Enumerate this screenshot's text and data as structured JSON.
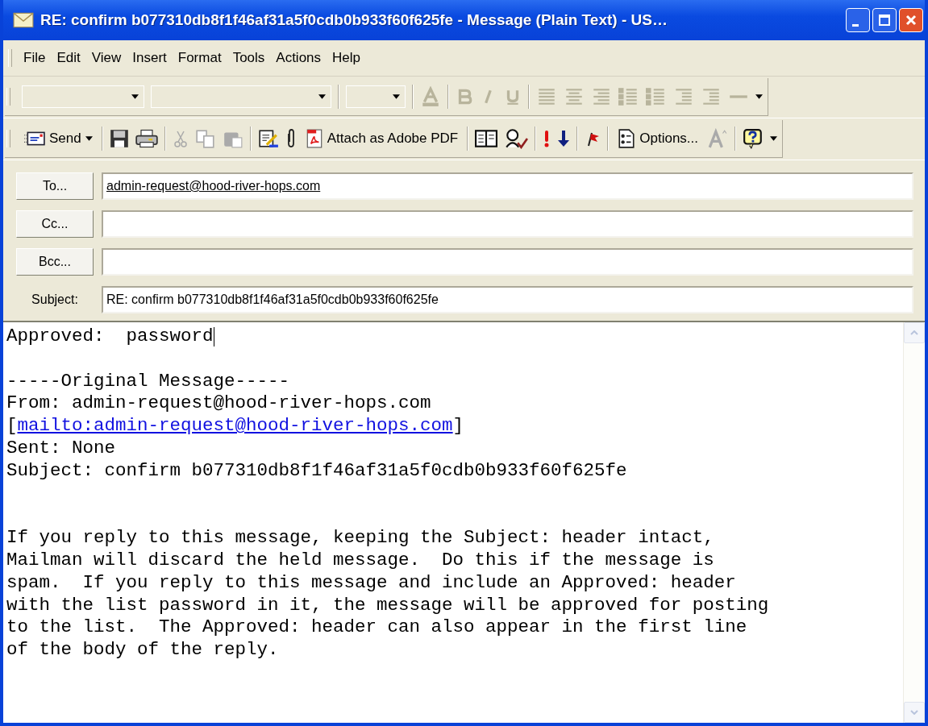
{
  "window": {
    "title": "RE: confirm b077310db8f1f46af31a5f0cdb0b933f60f625fe - Message (Plain Text)  - US…"
  },
  "menu": [
    {
      "label": "File"
    },
    {
      "label": "Edit"
    },
    {
      "label": "View"
    },
    {
      "label": "Insert"
    },
    {
      "label": "Format"
    },
    {
      "label": "Tools"
    },
    {
      "label": "Actions"
    },
    {
      "label": "Help"
    }
  ],
  "formatting_toolbar": {
    "disabled": true
  },
  "standard_toolbar": {
    "send_label": "Send",
    "attach_label": "Attach as Adobe PDF",
    "options_label": "Options...",
    "clipboard_disabled": true
  },
  "header": {
    "fields": [
      {
        "kind": "button",
        "label": "To...",
        "value": "admin-request@hood-river-hops.com"
      },
      {
        "kind": "button",
        "label": "Cc..."
      },
      {
        "kind": "button",
        "label": "Bcc..."
      },
      {
        "kind": "text",
        "label": "Subject:",
        "value": "RE: confirm b077310db8f1f46af31a5f0cdb0b933f60f625fe"
      }
    ]
  },
  "body": {
    "lines": [
      {
        "kind": "text",
        "text": "Approved:  password",
        "cursor": true
      },
      {
        "kind": "blank"
      },
      {
        "kind": "text",
        "text": "-----Original Message-----"
      },
      {
        "kind": "text",
        "text": "From: admin-request@hood-river-hops.com"
      },
      {
        "kind": "link",
        "before": "[",
        "link": "mailto:admin-request@hood-river-hops.com",
        "after": "]"
      },
      {
        "kind": "text",
        "text": "Sent: None"
      },
      {
        "kind": "text",
        "text": "Subject: confirm b077310db8f1f46af31a5f0cdb0b933f60f625fe"
      },
      {
        "kind": "blank"
      },
      {
        "kind": "blank"
      },
      {
        "kind": "text",
        "text": "If you reply to this message, keeping the Subject: header intact,"
      },
      {
        "kind": "text",
        "text": "Mailman will discard the held message.  Do this if the message is"
      },
      {
        "kind": "text",
        "text": "spam.  If you reply to this message and include an Approved: header"
      },
      {
        "kind": "text",
        "text": "with the list password in it, the message will be approved for posting"
      },
      {
        "kind": "text",
        "text": "to the list.  The Approved: header can also appear in the first line"
      },
      {
        "kind": "text",
        "text": "of the body of the reply."
      }
    ]
  }
}
